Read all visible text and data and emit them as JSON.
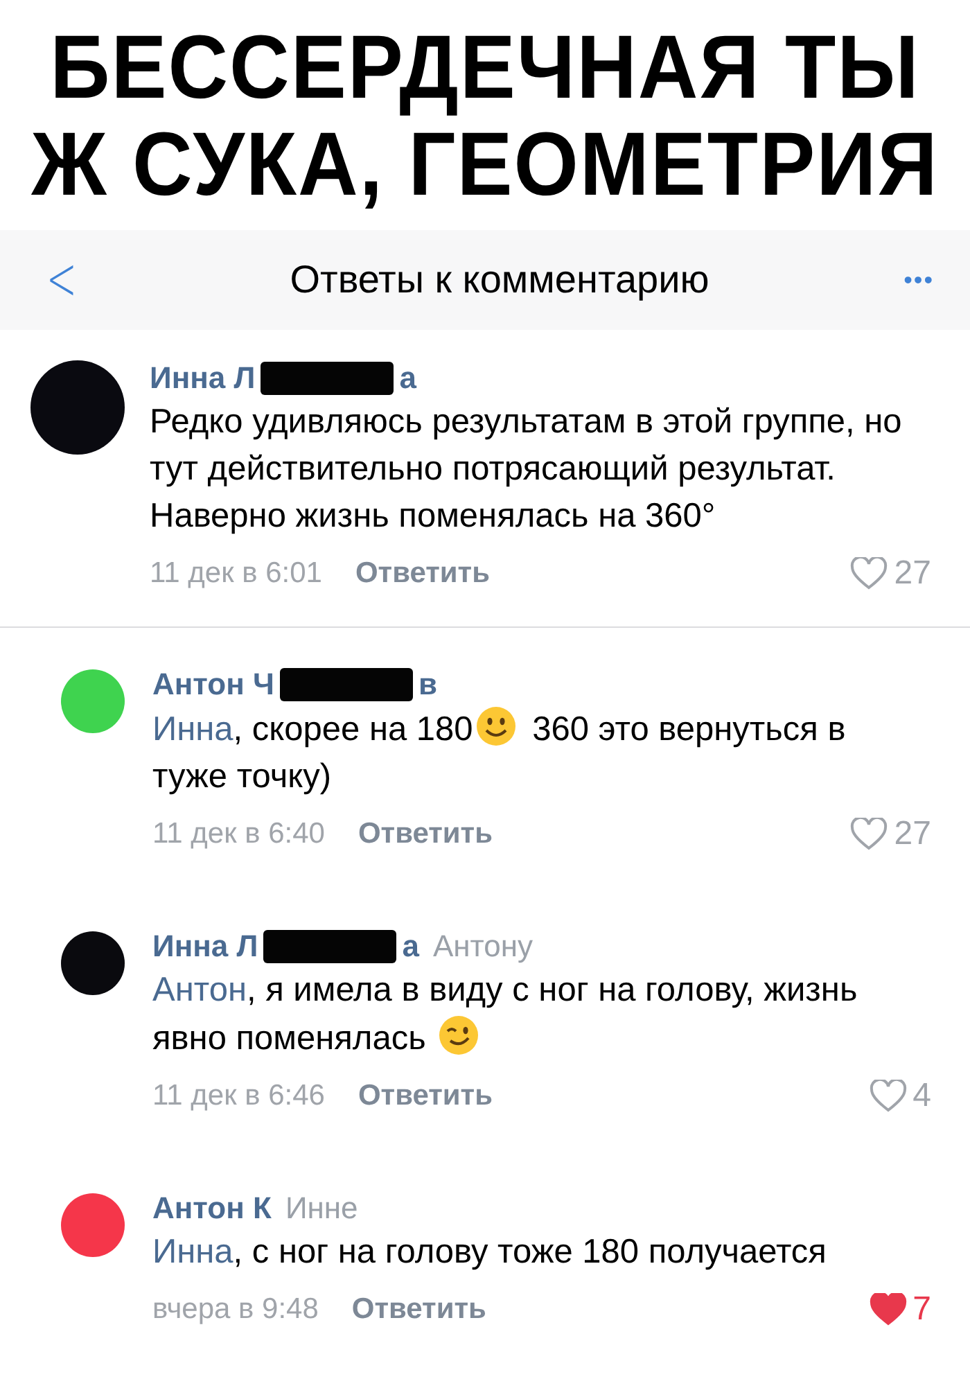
{
  "caption": [
    "БЕССЕРДЕЧНАЯ ТЫ",
    "Ж СУКА, ГЕОМЕТРИЯ"
  ],
  "header": {
    "back": "<",
    "title": "Ответы к комментарию",
    "more": "•••"
  },
  "comments": [
    {
      "kind": "root",
      "color": "#0a0a10",
      "name_start": "Инна Л",
      "redacted": true,
      "name_end": "а",
      "body": [
        {
          "kind": "text",
          "text": "Редко удивляюсь результатам в этой группе, но тут действительно потрясающий результат. Наверно жизнь поменялась на 360°"
        }
      ],
      "time": "11 дек в 6:01",
      "reply": "Ответить",
      "liked": false,
      "likes": "27"
    },
    {
      "kind": "reply",
      "color": "#3fd34f",
      "name_start": "Антон Ч",
      "redacted": true,
      "name_end": "в",
      "body": [
        {
          "kind": "mention",
          "text": "Инна"
        },
        {
          "kind": "text",
          "text": ", скорее на 180"
        },
        {
          "kind": "smile"
        },
        {
          "kind": "text",
          "text": " 360 это вернуться в туже точку)"
        }
      ],
      "time": "11 дек в 6:40",
      "reply": "Ответить",
      "liked": false,
      "likes": "27"
    },
    {
      "kind": "reply",
      "color": "#0a0a0e",
      "name_start": "Инна Л",
      "redacted": true,
      "name_end": "а",
      "reply_to": "Антону",
      "body": [
        {
          "kind": "mention",
          "text": "Антон"
        },
        {
          "kind": "text",
          "text": ", я имела в виду с ног на голову, жизнь явно поменялась "
        },
        {
          "kind": "wink"
        }
      ],
      "time": "11 дек в 6:46",
      "reply": "Ответить",
      "liked": false,
      "likes": "4"
    },
    {
      "kind": "reply",
      "color": "#f5364a",
      "name_start": "Антон К",
      "redacted": false,
      "reply_to": "Инне",
      "body": [
        {
          "kind": "mention",
          "text": "Инна"
        },
        {
          "kind": "text",
          "text": ", с ног на голову тоже 180 получается"
        }
      ],
      "time": "вчера в 9:48",
      "reply": "Ответить",
      "liked": true,
      "likes": "7"
    }
  ]
}
